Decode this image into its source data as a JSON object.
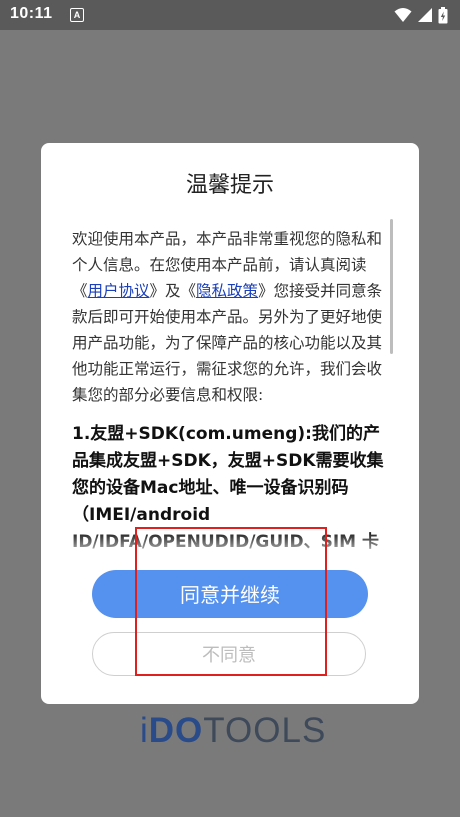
{
  "status_bar": {
    "time": "10:11",
    "notification_glyph": "A",
    "icons": [
      "wifi-icon",
      "signal-icon",
      "battery-icon"
    ]
  },
  "dialog": {
    "title": "温馨提示",
    "intro_before_links": "欢迎使用本产品，本产品非常重视您的隐私和个人信息。在您使用本产品前，请认真阅读《",
    "user_agreement_link": "用户协议",
    "between_links": "》及《",
    "privacy_policy_link": "隐私政策",
    "intro_after_links": "》您接受并同意条款后即可开始使用本产品。另外为了更好地使用产品功能，为了保障产品的核心功能以及其他功能正常运行，需征求您的允许，我们会收集您的部分必要信息和权限:",
    "section1": "1.友盟+SDK(com.umeng):我们的产品集成友盟+SDK，友盟+SDK需要收集您的设备Mac地址、唯一设备识别码（IMEI/android ID/IDFA/OPENUDID/GUID、SIM 卡 IMSI 信息）",
    "agree_button": "同意并继续",
    "disagree_button": "不同意"
  },
  "brand": {
    "logo_i": "i",
    "logo_do": "DO",
    "logo_tools": "TOOLS"
  },
  "colors": {
    "accent": "#5591ee",
    "link": "#1a3fb8",
    "highlight": "#e01f1f",
    "overlay": "#7a7a7a"
  }
}
